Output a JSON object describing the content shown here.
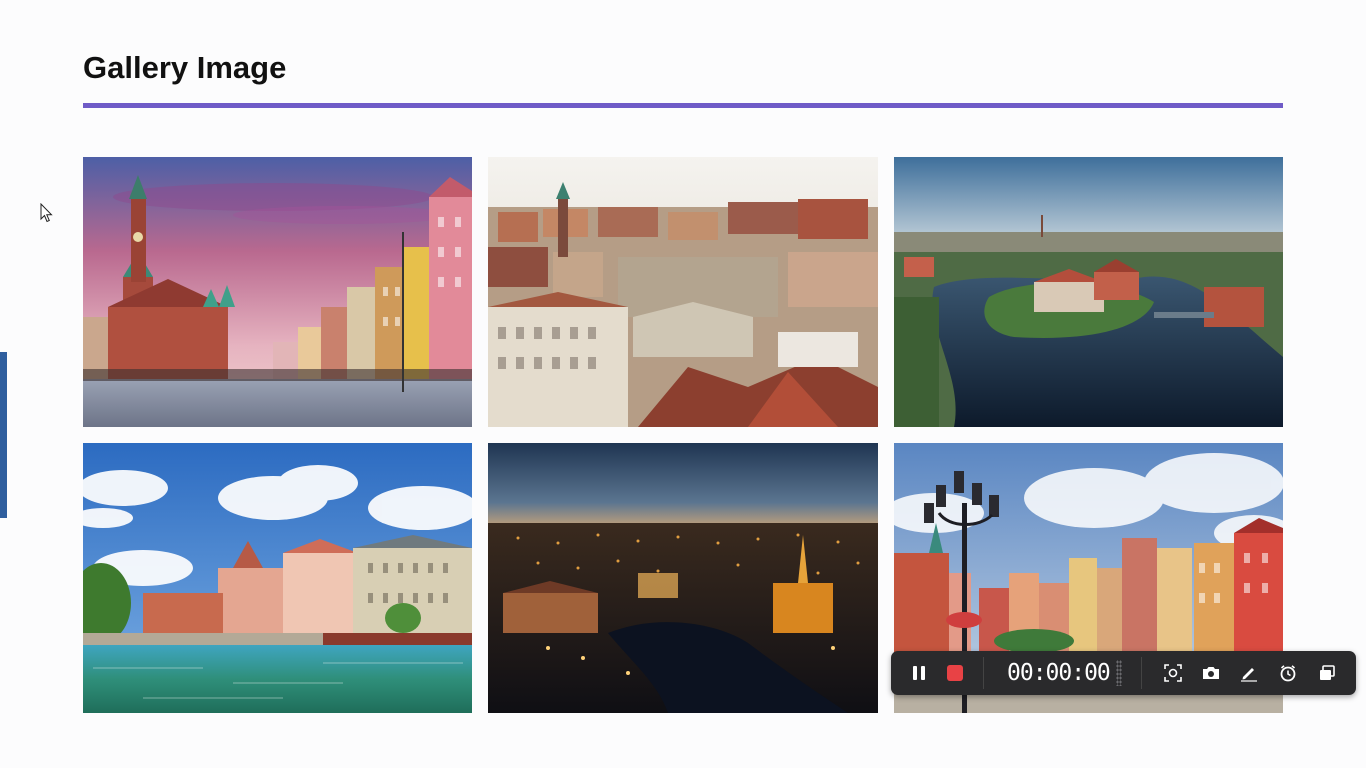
{
  "page": {
    "title": "Gallery Image",
    "accent_color": "#6f5bc7"
  },
  "gallery": {
    "images": [
      {
        "scene": "old-town-square-sunset"
      },
      {
        "scene": "aerial-old-town-rooftops"
      },
      {
        "scene": "aerial-river-island"
      },
      {
        "scene": "riverside-sunny-day"
      },
      {
        "scene": "city-at-night-aerial"
      },
      {
        "scene": "market-square-lamppost"
      }
    ]
  },
  "recorder": {
    "timer": "00:00:00",
    "record_color": "#e84245",
    "icons": [
      "pause-icon",
      "stop-record-icon",
      "region-capture-icon",
      "camera-icon",
      "pen-icon",
      "timer-icon",
      "window-icon"
    ]
  }
}
